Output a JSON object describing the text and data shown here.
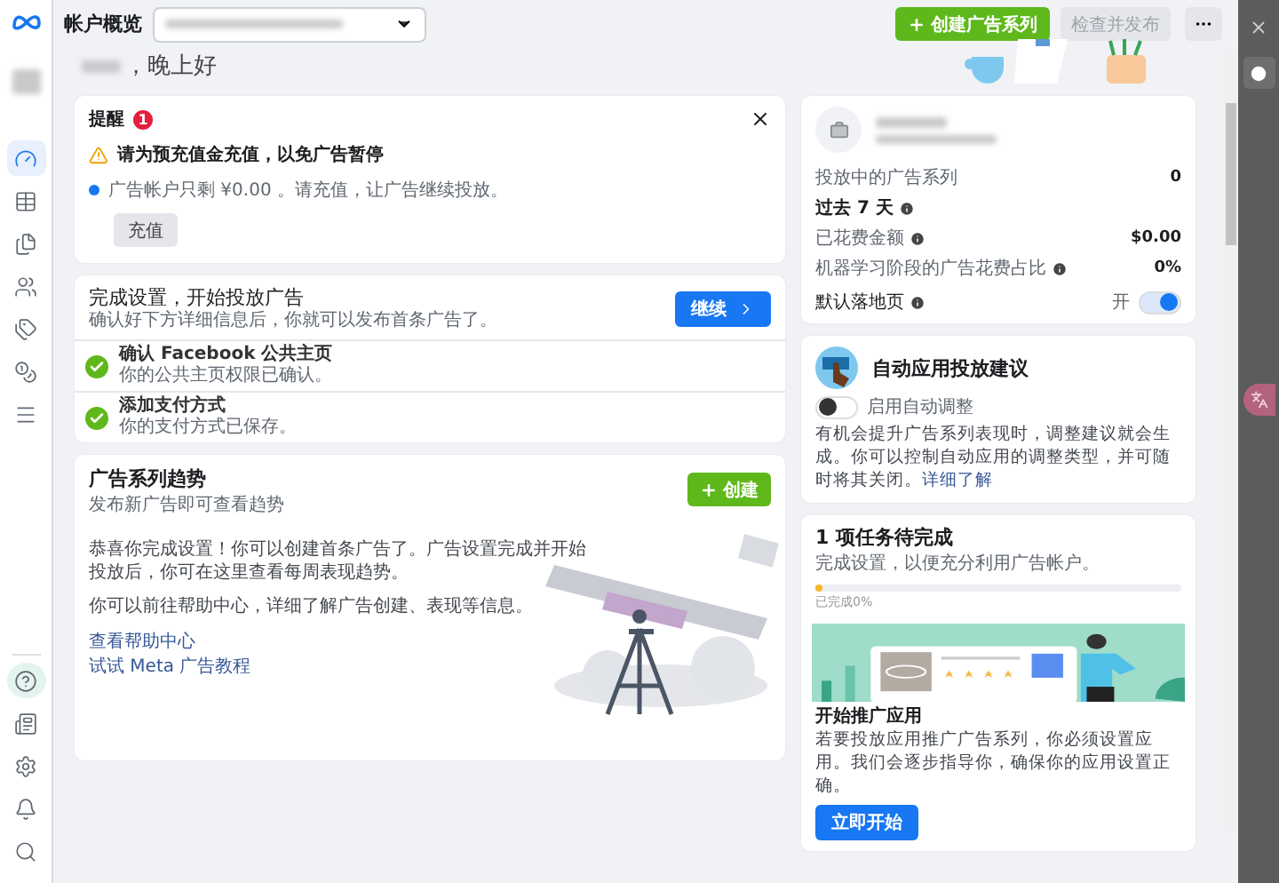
{
  "header": {
    "title": "帐户概览",
    "create_button": "创建广告系列",
    "review_button": "检查并发布"
  },
  "sidebar": {
    "items": [
      {
        "kind": "dashboard",
        "selected": true
      },
      {
        "kind": "table",
        "selected": false
      },
      {
        "kind": "pages",
        "selected": false
      },
      {
        "kind": "audience",
        "selected": false
      },
      {
        "kind": "tags",
        "selected": false
      },
      {
        "kind": "billing",
        "selected": false
      },
      {
        "kind": "menu",
        "selected": false
      }
    ],
    "bottom_items": [
      {
        "kind": "help",
        "selected": true
      },
      {
        "kind": "news",
        "selected": false
      },
      {
        "kind": "settings",
        "selected": false
      },
      {
        "kind": "bell",
        "selected": false
      },
      {
        "kind": "search",
        "selected": false
      }
    ]
  },
  "greeting": "，晚上好",
  "reminder": {
    "title": "提醒",
    "count": "1",
    "warning": "请为预充值金充值，以免广告暂停",
    "message": "广告帐户只剩 ¥0.00 。请充值，让广告继续投放。",
    "button": "充值"
  },
  "setup": {
    "title": "完成设置，开始投放广告",
    "subtitle": "确认好下方详细信息后，你就可以发布首条广告了。",
    "button": "继续",
    "steps": [
      {
        "title": "确认 Facebook 公共主页",
        "desc": "你的公共主页权限已确认。",
        "done": true
      },
      {
        "title": "添加支付方式",
        "desc": "你的支付方式已保存。",
        "done": true
      }
    ]
  },
  "trends": {
    "title": "广告系列趋势",
    "subtitle": "发布新广告即可查看趋势",
    "create_button": "创建",
    "paragraphs": [
      "恭喜你完成设置！你可以创建首条广告了。广告设置完成并开始投放后，你可在这里查看每周表现趋势。",
      "你可以前往帮助中心，详细了解广告创建、表现等信息。"
    ],
    "links": [
      "查看帮助中心",
      "试试 Meta 广告教程"
    ]
  },
  "account": {
    "stats": [
      {
        "kind": "row",
        "label": "投放中的广告系列",
        "value": "0",
        "info": false
      },
      {
        "kind": "heading",
        "label": "过去 7 天",
        "info": true
      },
      {
        "kind": "row",
        "label": "已花费金额",
        "value": "$0.00",
        "info": true
      },
      {
        "kind": "row",
        "label": "机器学习阶段的广告花费占比",
        "value": "0%",
        "info": true
      }
    ],
    "default_landing": {
      "label": "默认落地页",
      "info": true,
      "state_label": "开",
      "on": true
    }
  },
  "auto_apply": {
    "title": "自动应用投放建议",
    "toggle_label": "启用自动调整",
    "on": false,
    "description": "有机会提升广告系列表现时，调整建议就会生成。你可以控制自动应用的调整类型，并可随时将其关闭。",
    "link": "详细了解"
  },
  "tasks": {
    "title": "1 项任务待完成",
    "subtitle": "完成设置，以便充分利用广告帐户。",
    "level": 0.02,
    "progress_label": "已完成0%",
    "promo_title": "开始推广应用",
    "promo_text": "若要投放应用推广广告系列，你必须设置应用。我们会逐步指导你，确保你的应用设置正确。",
    "button": "立即开始"
  }
}
